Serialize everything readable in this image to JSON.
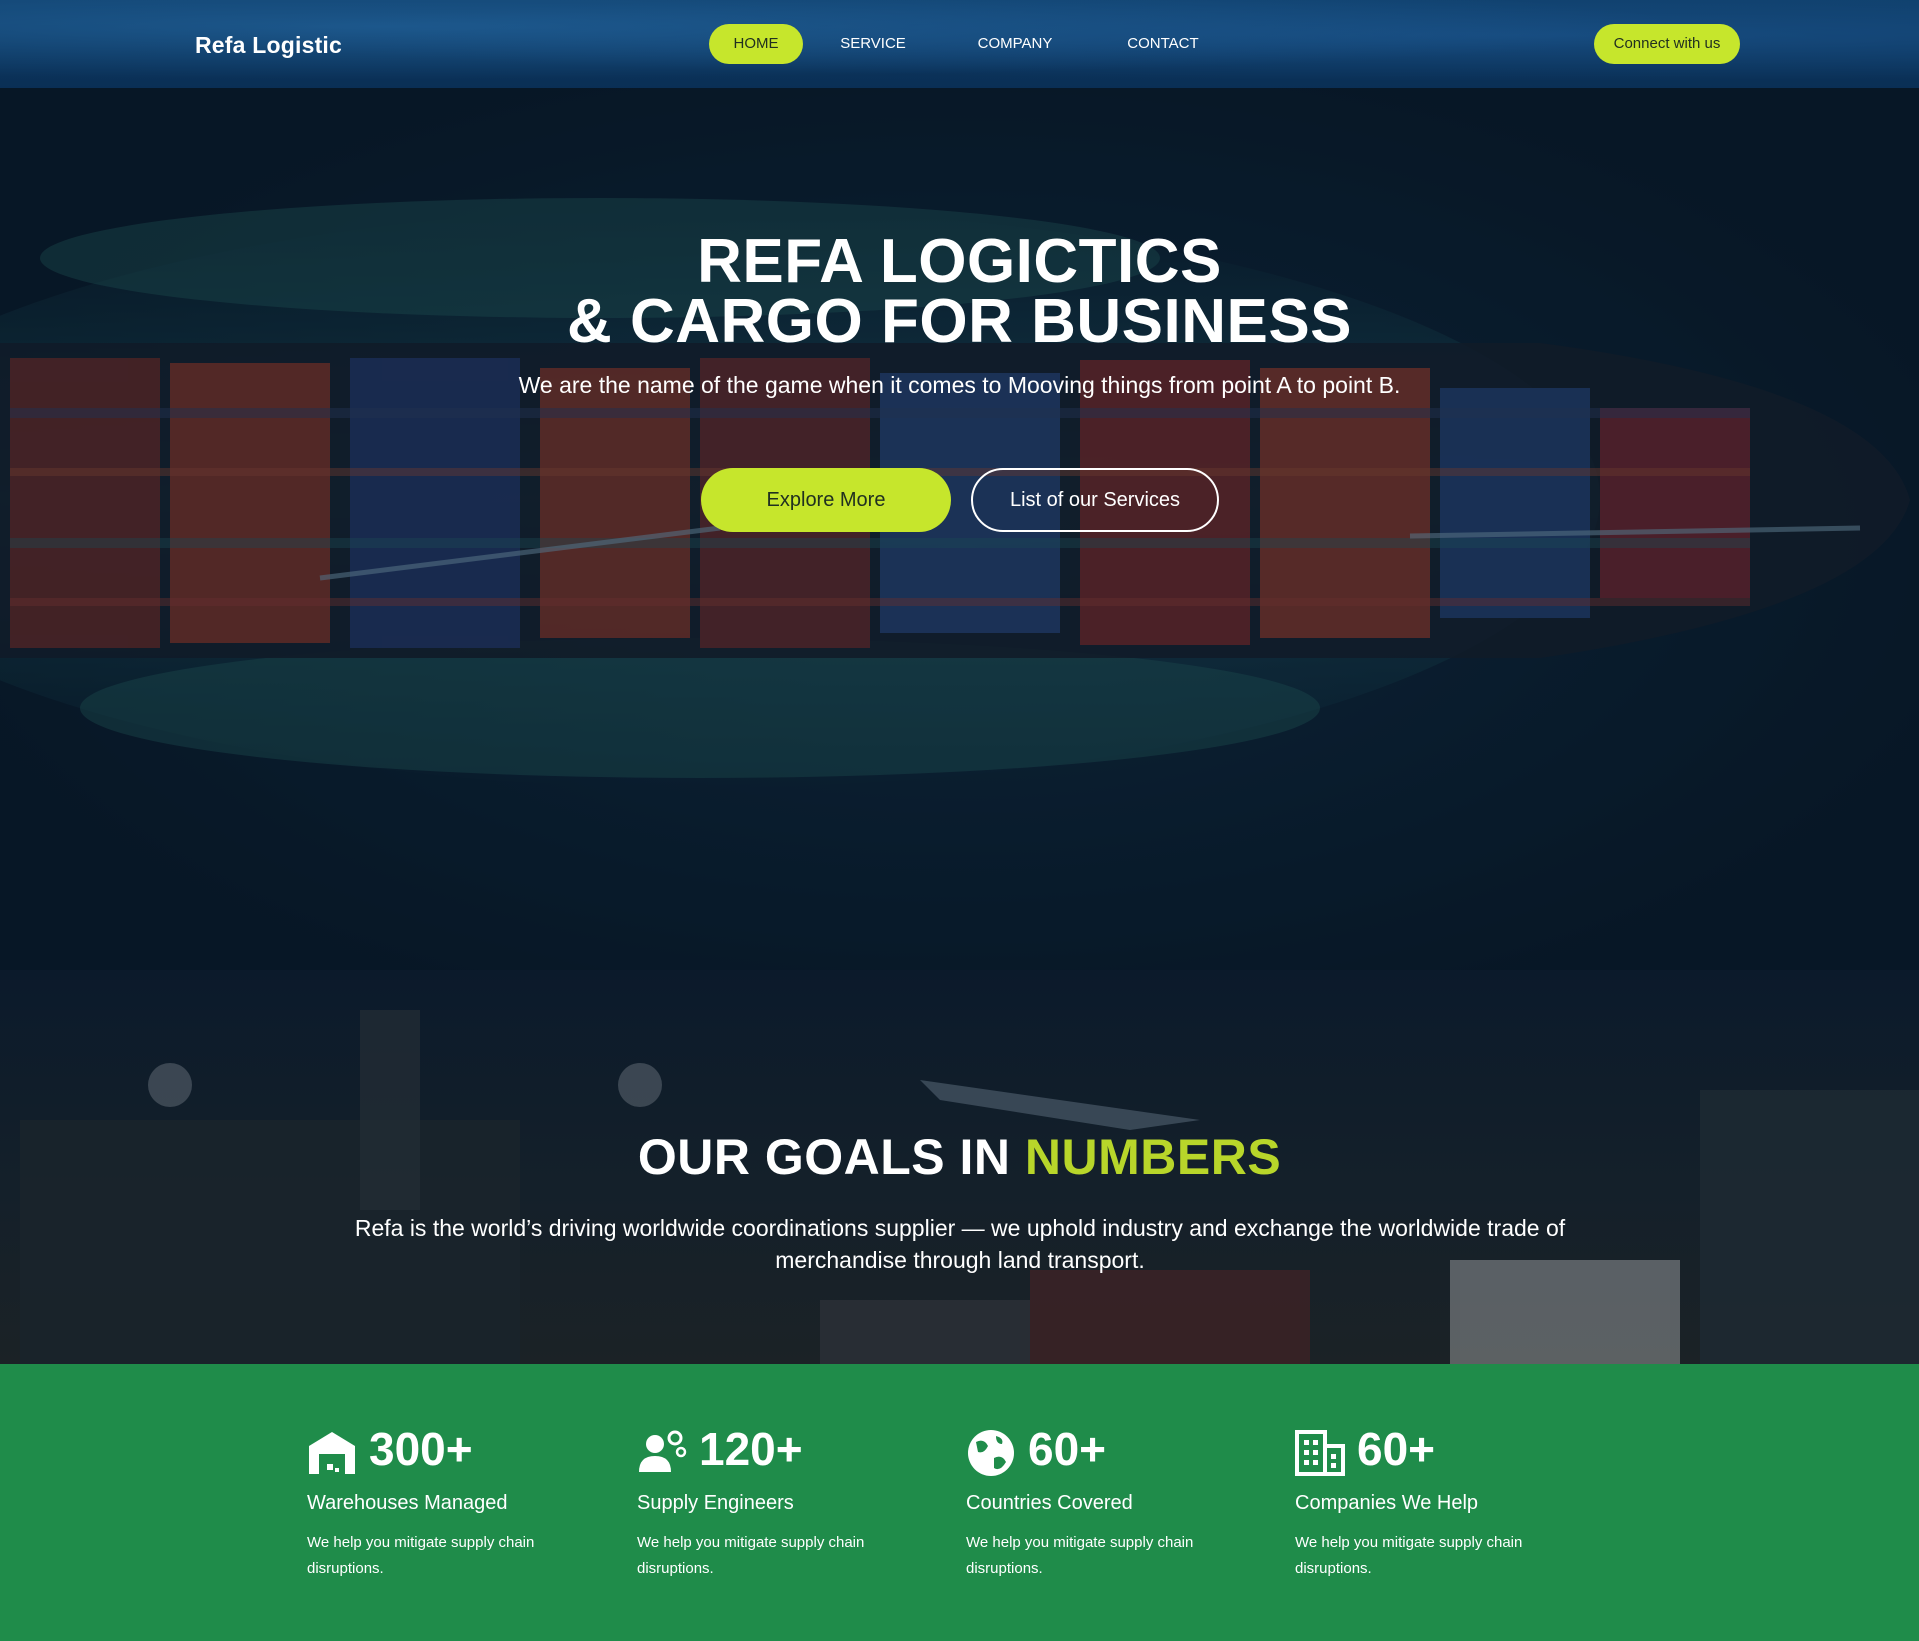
{
  "brand": {
    "logo": "Refa Logistic"
  },
  "nav": {
    "items": [
      {
        "label": "HOME",
        "active": true
      },
      {
        "label": "SERVICE",
        "active": false
      },
      {
        "label": "COMPANY",
        "active": false
      },
      {
        "label": "CONTACT",
        "active": false
      }
    ],
    "cta_label": "Connect with us"
  },
  "hero": {
    "title_line1": "REFA LOGICTICS",
    "title_line2": "& CARGO FOR BUSINESS",
    "subtitle": "We are the name of the game when it comes to Mooving things from point A to point B.",
    "primary_button": "Explore More",
    "secondary_button": "List of our Services"
  },
  "goals": {
    "title_main": "OUR GOALS IN ",
    "title_accent": "NUMBERS",
    "text": "Refa is the world’s driving worldwide coordinations supplier — we uphold industry and exchange the worldwide trade of merchandise through land transport."
  },
  "stats": [
    {
      "icon": "warehouse-icon",
      "number": "300+",
      "label": "Warehouses Managed",
      "desc": "We help you mitigate supply chain disruptions."
    },
    {
      "icon": "engineer-icon",
      "number": "120+",
      "label": "Supply Engineers",
      "desc": "We help you mitigate supply chain disruptions."
    },
    {
      "icon": "globe-icon",
      "number": "60+",
      "label": "Countries Covered",
      "desc": "We help you mitigate supply chain disruptions."
    },
    {
      "icon": "building-icon",
      "number": "60+",
      "label": "Companies We Help",
      "desc": "We help you mitigate supply chain disruptions."
    }
  ],
  "colors": {
    "accent": "#c6e62c",
    "accent_text": "#b8d62a",
    "stats_bg": "#1f8c4a",
    "nav_bg": "#0f3f6b",
    "hero_bg": "#0d2337"
  }
}
